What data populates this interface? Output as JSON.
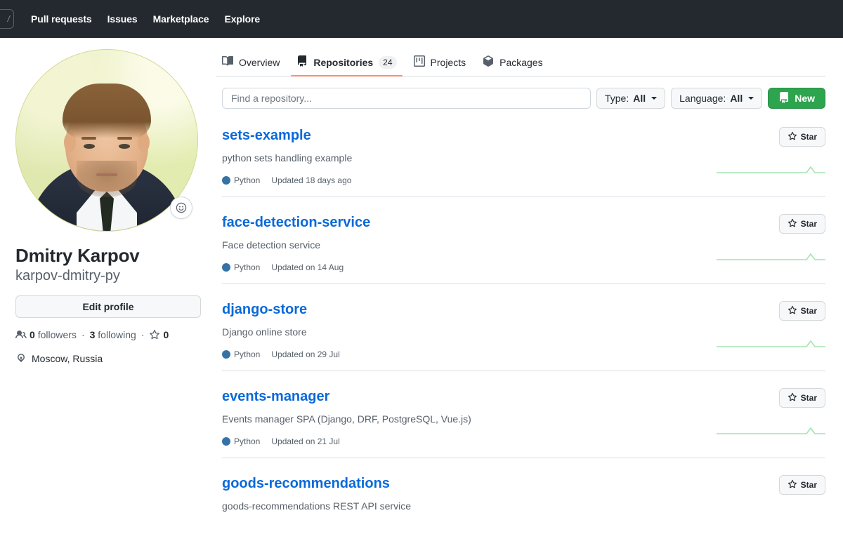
{
  "topbar": {
    "search_shortcut": "/",
    "nav": [
      {
        "label": "Pull requests"
      },
      {
        "label": "Issues"
      },
      {
        "label": "Marketplace"
      },
      {
        "label": "Explore"
      }
    ]
  },
  "profile": {
    "avatar_alt": "avatar",
    "status_emoji": "smiley-icon",
    "name": "Dmitry Karpov",
    "login": "karpov-dmitry-py",
    "edit_button": "Edit profile",
    "followers_count": "0",
    "followers_label": "followers",
    "following_count": "3",
    "following_label": "following",
    "stars_count": "0",
    "location": "Moscow, Russia"
  },
  "tabs": [
    {
      "label": "Overview",
      "icon": "book-icon",
      "count": null,
      "active": false
    },
    {
      "label": "Repositories",
      "icon": "repo-icon",
      "count": "24",
      "active": true
    },
    {
      "label": "Projects",
      "icon": "project-icon",
      "count": null,
      "active": false
    },
    {
      "label": "Packages",
      "icon": "package-icon",
      "count": null,
      "active": false
    }
  ],
  "filters": {
    "search_placeholder": "Find a repository...",
    "search_value": "",
    "type_label": "Type:",
    "type_value": "All",
    "language_label": "Language:",
    "language_value": "All",
    "new_button": "New"
  },
  "star_button_label": "Star",
  "colors": {
    "accent_blue": "#0969da",
    "tab_underline": "#fd8c73",
    "new_green": "#2da44e",
    "python_dot": "#3572A5",
    "sparkline_green": "#a4e3b0",
    "header_dark": "#24292f"
  },
  "repositories": [
    {
      "name": "sets-example",
      "description": "python sets handling example",
      "language": "Python",
      "language_color": "#3572A5",
      "updated": "Updated 18 days ago"
    },
    {
      "name": "face-detection-service",
      "description": "Face detection service",
      "language": "Python",
      "language_color": "#3572A5",
      "updated": "Updated on 14 Aug"
    },
    {
      "name": "django-store",
      "description": "Django online store",
      "language": "Python",
      "language_color": "#3572A5",
      "updated": "Updated on 29 Jul"
    },
    {
      "name": "events-manager",
      "description": "Events manager SPA (Django, DRF, PostgreSQL, Vue.js)",
      "language": "Python",
      "language_color": "#3572A5",
      "updated": "Updated on 21 Jul"
    },
    {
      "name": "goods-recommendations",
      "description": "goods-recommendations REST API service",
      "language": "",
      "language_color": "",
      "updated": ""
    }
  ]
}
